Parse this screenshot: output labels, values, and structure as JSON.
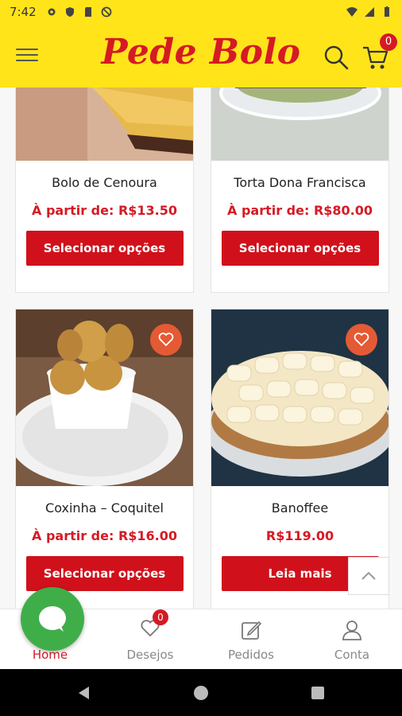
{
  "status": {
    "time": "7:42"
  },
  "header": {
    "logo": "Pede Bolo",
    "cart_count": "0"
  },
  "products": [
    {
      "name": "Bolo de Cenoura",
      "price": "À partir de: R$13.50",
      "cta": "Selecionar opções"
    },
    {
      "name": "Torta Dona Francisca",
      "price": "À partir de: R$80.00",
      "cta": "Selecionar opções"
    },
    {
      "name": "Coxinha – Coquitel",
      "price": "À partir de: R$16.00",
      "cta": "Selecionar opções"
    },
    {
      "name": "Banoffee",
      "price": "R$119.00",
      "cta": "Leia mais"
    }
  ],
  "bottom_nav": {
    "items": [
      {
        "label": "Home"
      },
      {
        "label": "Desejos"
      },
      {
        "label": "Pedidos"
      },
      {
        "label": "Conta"
      }
    ],
    "wishlist_count": "0"
  },
  "colors": {
    "brand_yellow": "#FFE41A",
    "brand_red": "#D51A24",
    "chat_green": "#3FAE49"
  }
}
